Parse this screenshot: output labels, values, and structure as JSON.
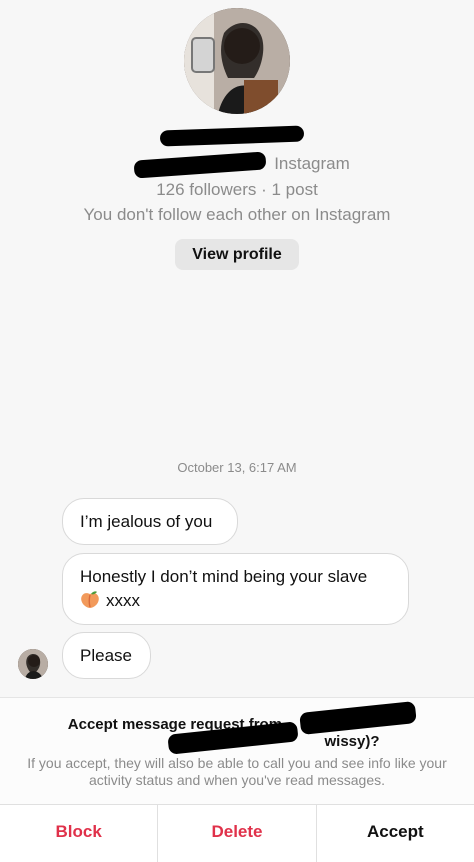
{
  "profile": {
    "handle_suffix": "Instagram",
    "stats": "126 followers · 1 post",
    "follow_note": "You don't follow each other on Instagram",
    "view_profile_label": "View profile"
  },
  "conversation": {
    "timestamp": "October 13, 6:17 AM",
    "messages": [
      {
        "text": "I’m jealous of you"
      },
      {
        "line1": "Honestly I don’t mind being your slave",
        "line2": "xxxx"
      },
      {
        "text": "Please"
      }
    ]
  },
  "request": {
    "title_prefix": "Accept message request from",
    "title_suffix": "wissy)?",
    "note": "If you accept, they will also be able to call you and see info like your activity status and when you've read messages."
  },
  "actions": {
    "block": "Block",
    "delete": "Delete",
    "accept": "Accept"
  },
  "colors": {
    "destructive": "#e0314a",
    "background": "#f7f7f7"
  }
}
